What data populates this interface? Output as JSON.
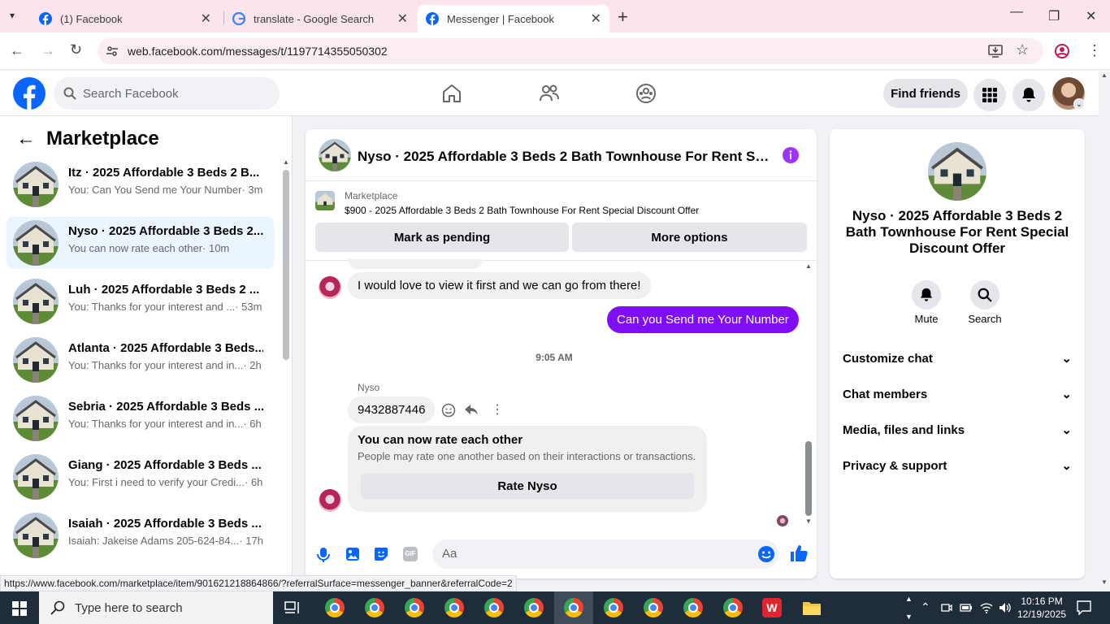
{
  "browser": {
    "tabs": [
      {
        "title": "(1) Facebook"
      },
      {
        "title": "translate - Google Search"
      },
      {
        "title": "Messenger | Facebook"
      }
    ],
    "url": "web.facebook.com/messages/t/1197714355050302",
    "status_url": "https://www.facebook.com/marketplace/item/901621218864866/?referralSurface=messenger_banner&referralCode=2"
  },
  "fb_header": {
    "search_placeholder": "Search Facebook",
    "find_friends": "Find friends"
  },
  "sidebar": {
    "title": "Marketplace",
    "conversations": [
      {
        "name": "Itz · 2025 Affordable 3 Beds 2 B...",
        "preview": "You: Can You Send me Your Number",
        "time": "· 3m"
      },
      {
        "name": "Nyso · 2025 Affordable 3 Beds 2...",
        "preview": "You can now rate each other",
        "time": "· 10m",
        "selected": true
      },
      {
        "name": "Luh · 2025 Affordable 3 Beds 2 ...",
        "preview": "You: Thanks for your interest and ...",
        "time": "· 53m"
      },
      {
        "name": "Atlanta · 2025 Affordable 3 Beds...",
        "preview": "You: Thanks for your interest and in...",
        "time": "· 2h"
      },
      {
        "name": "Sebria · 2025 Affordable 3 Beds ...",
        "preview": "You: Thanks for your interest and in...",
        "time": "· 6h"
      },
      {
        "name": "Giang · 2025 Affordable 3 Beds ...",
        "preview": "You: First i need to verify your Credi...",
        "time": "· 6h"
      },
      {
        "name": "Isaiah · 2025 Affordable 3 Beds ...",
        "preview": "Isaiah: Jakeise Adams 205-624-84...",
        "time": "· 17h"
      }
    ]
  },
  "chat": {
    "title": "Nyso · 2025 Affordable 3 Beds 2 Bath Townhouse For Rent Special Discount Offer",
    "banner_label": "Marketplace",
    "banner_listing": "$900 - 2025 Affordable 3 Beds 2 Bath Townhouse For Rent Special Discount Offer",
    "mark_pending": "Mark as pending",
    "more_options": "More options",
    "msg_in_1": "I would love to view it first and we can go from there!",
    "msg_out_1": "Can you Send me Your Number",
    "timestamp": "9:05 AM",
    "sender": "Nyso",
    "msg_in_2": "9432887446",
    "rate_title": "You can now rate each other",
    "rate_desc": "People may rate one another based on their interactions or transactions.",
    "rate_button": "Rate Nyso",
    "composer_placeholder": "Aa"
  },
  "info_panel": {
    "name": "Nyso · 2025 Affordable 3 Beds 2 Bath Townhouse For Rent Special Discount Offer",
    "mute": "Mute",
    "search": "Search",
    "sections": [
      "Customize chat",
      "Chat members",
      "Media, files and links",
      "Privacy & support"
    ]
  },
  "taskbar": {
    "search_placeholder": "Type here to search",
    "time": "10:16 PM",
    "date": "12/19/2025"
  },
  "colors": {
    "fb_blue": "#0866ff",
    "messenger_purple": "#7f0ef6"
  }
}
